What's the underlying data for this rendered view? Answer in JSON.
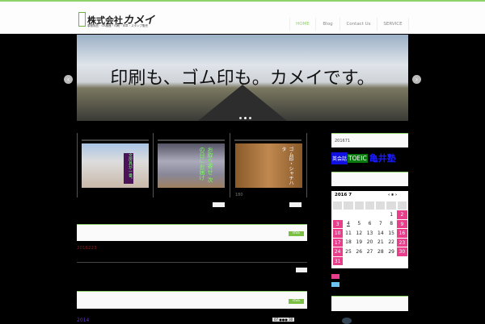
{
  "header": {
    "logo_name": "株式会社",
    "logo_brand": "カメイ",
    "logo_sub": "事務用品・OA機器・印刷・印章・スタンプ販売",
    "nav": [
      "HOME",
      "Blog",
      "Contact Us",
      "SERVICE"
    ]
  },
  "hero": {
    "headline": "印刷も、ゴム印も。カメイです。",
    "prev": "‹",
    "next": "›"
  },
  "cards": [
    {
      "caption": ""
    },
    {
      "caption": ""
    },
    {
      "caption": "180"
    }
  ],
  "card_images": [
    {
      "text": "文房具が一番。"
    },
    {
      "text": "お取り寄せ 次の日にお届け"
    },
    {
      "text": "ゴム印・シャチハタ"
    }
  ],
  "posts": [
    {
      "rss": "RSS",
      "date": "2016223"
    },
    {
      "rss": "RSS",
      "date": "2014",
      "meta": "07 ●●● 30"
    }
  ],
  "sidebar": {
    "box1": "201671",
    "banner": {
      "a": "英会話",
      "b": "TOEIC",
      "c": "亀井塾"
    },
    "calendar": {
      "title": "2016 7",
      "controls": "‹ ⏸ ›",
      "days": [
        "",
        "",
        "",
        "",
        "",
        "1",
        "2",
        "3",
        "4",
        "5",
        "6",
        "7",
        "8",
        "9",
        "10",
        "11",
        "12",
        "13",
        "14",
        "15",
        "16",
        "17",
        "18",
        "19",
        "20",
        "21",
        "22",
        "23",
        "24",
        "25",
        "26",
        "27",
        "28",
        "29",
        "30",
        "31"
      ]
    },
    "legend_colors": [
      "#e83e8c",
      "#6cc3f0"
    ]
  },
  "colors": {
    "accent": "#8fd16a",
    "holiday": "#e83e8c"
  }
}
